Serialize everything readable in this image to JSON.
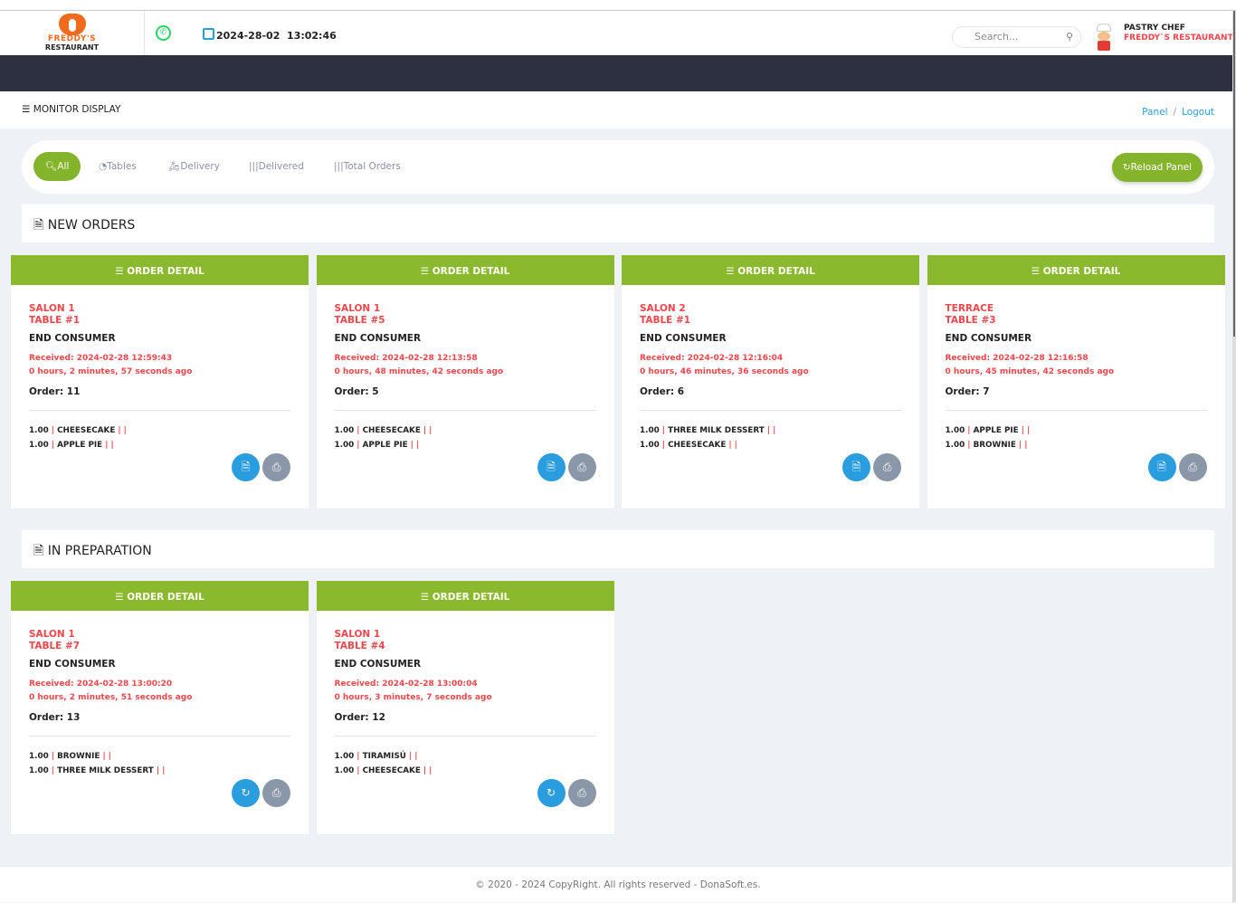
{
  "brand": {
    "name_line1": "FREDDY'S",
    "name_line2": "RESTAURANT",
    "accent": "#8ab92d",
    "alert": "#f0474d"
  },
  "header": {
    "date": "2024-28-02",
    "time": "13:02:46",
    "search_placeholder": "Search...",
    "user_role": "PASTRY CHEF",
    "user_company": "FREDDY`S RESTAURANT"
  },
  "page": {
    "title": "MONITOR DISPLAY",
    "breadcrumb": [
      "Panel",
      "Logout"
    ]
  },
  "filters": {
    "items": [
      "All",
      "Tables",
      "Delivery",
      "Delivered",
      "Total Orders"
    ],
    "active": "All",
    "reload": "Reload Panel"
  },
  "sections": {
    "new": "NEW ORDERS",
    "prep": "IN PREPARATION"
  },
  "card_header": "ORDER DETAIL",
  "new_orders": [
    {
      "area": "SALON 1",
      "table": "TABLE #1",
      "customer": "END CONSUMER",
      "received": "Received: 2024-02-28 12:59:43",
      "elapsed": "0 hours, 2 minutes, 57 seconds ago",
      "order": "Order: 11",
      "items": [
        {
          "qty": "1.00",
          "name": "CHEESECAKE"
        },
        {
          "qty": "1.00",
          "name": "APPLE PIE"
        }
      ]
    },
    {
      "area": "SALON 1",
      "table": "TABLE #5",
      "customer": "END CONSUMER",
      "received": "Received: 2024-02-28 12:13:58",
      "elapsed": "0 hours, 48 minutes, 42 seconds ago",
      "order": "Order: 5",
      "items": [
        {
          "qty": "1.00",
          "name": "CHEESECAKE"
        },
        {
          "qty": "1.00",
          "name": "APPLE PIE"
        }
      ]
    },
    {
      "area": "SALON 2",
      "table": "TABLE #1",
      "customer": "END CONSUMER",
      "received": "Received: 2024-02-28 12:16:04",
      "elapsed": "0 hours, 46 minutes, 36 seconds ago",
      "order": "Order: 6",
      "items": [
        {
          "qty": "1.00",
          "name": "THREE MILK DESSERT"
        },
        {
          "qty": "1.00",
          "name": "CHEESECAKE"
        }
      ]
    },
    {
      "area": "TERRACE",
      "table": "TABLE #3",
      "customer": "END CONSUMER",
      "received": "Received: 2024-02-28 12:16:58",
      "elapsed": "0 hours, 45 minutes, 42 seconds ago",
      "order": "Order: 7",
      "items": [
        {
          "qty": "1.00",
          "name": "APPLE PIE"
        },
        {
          "qty": "1.00",
          "name": "BROWNIE"
        }
      ]
    }
  ],
  "prep_orders": [
    {
      "area": "SALON 1",
      "table": "TABLE #7",
      "customer": "END CONSUMER",
      "received": "Received: 2024-02-28 13:00:20",
      "elapsed": "0 hours, 2 minutes, 51 seconds ago",
      "order": "Order: 13",
      "items": [
        {
          "qty": "1.00",
          "name": "BROWNIE"
        },
        {
          "qty": "1.00",
          "name": "THREE MILK DESSERT"
        }
      ]
    },
    {
      "area": "SALON 1",
      "table": "TABLE #4",
      "customer": "END CONSUMER",
      "received": "Received: 2024-02-28 13:00:04",
      "elapsed": "0 hours, 3 minutes, 7 seconds ago",
      "order": "Order: 12",
      "items": [
        {
          "qty": "1.00",
          "name": "TIRAMISÚ"
        },
        {
          "qty": "1.00",
          "name": "CHEESECAKE"
        }
      ]
    }
  ],
  "footer": "© 2020 - 2024 CopyRight. All rights reserved - DonaSoft.es."
}
